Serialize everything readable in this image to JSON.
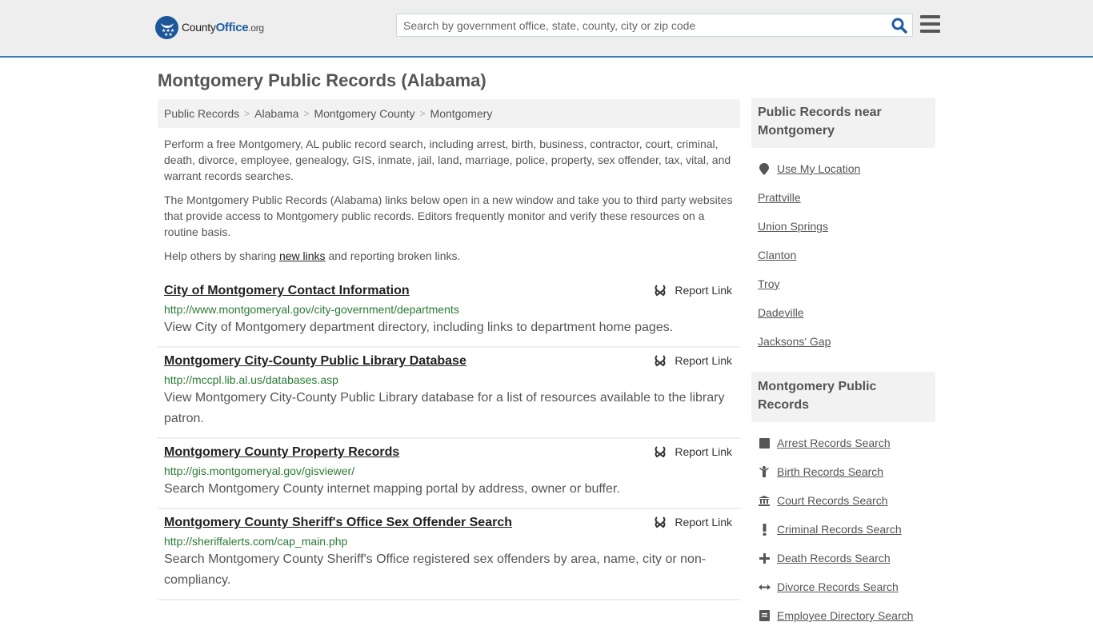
{
  "header": {
    "logo": {
      "county": "County",
      "office": "Office",
      "tld": ".org"
    },
    "search": {
      "placeholder": "Search by government office, state, county, city or zip code",
      "value": ""
    }
  },
  "page_title": "Montgomery Public Records (Alabama)",
  "breadcrumb": [
    "Public Records",
    "Alabama",
    "Montgomery County",
    "Montgomery"
  ],
  "intro": {
    "p1": "Perform a free Montgomery, AL public record search, including arrest, birth, business, contractor, court, criminal, death, divorce, employee, genealogy, GIS, inmate, jail, land, marriage, police, property, sex offender, tax, vital, and warrant records searches.",
    "p2": "The Montgomery Public Records (Alabama) links below open in a new window and take you to third party websites that provide access to Montgomery public records. Editors frequently monitor and verify these resources on a routine basis.",
    "p3_before": "Help others by sharing ",
    "p3_link": "new links",
    "p3_after": " and reporting broken links."
  },
  "report_label": "Report Link",
  "results": [
    {
      "title": "City of Montgomery Contact Information",
      "url": "http://www.montgomeryal.gov/city-government/departments",
      "desc": "View City of Montgomery department directory, including links to department home pages."
    },
    {
      "title": "Montgomery City-County Public Library Database",
      "url": "http://mccpl.lib.al.us/databases.asp",
      "desc": "View Montgomery City-County Public Library database for a list of resources available to the library patron."
    },
    {
      "title": "Montgomery County Property Records",
      "url": "http://gis.montgomeryal.gov/gisviewer/",
      "desc": "Search Montgomery County internet mapping portal by address, owner or buffer."
    },
    {
      "title": "Montgomery County Sheriff's Office Sex Offender Search",
      "url": "http://sheriffalerts.com/cap_main.php",
      "desc": "Search Montgomery County Sheriff's Office registered sex offenders by area, name, city or non-compliancy."
    }
  ],
  "sidebar": {
    "nearby": {
      "heading": "Public Records near Montgomery",
      "use_location": "Use My Location",
      "cities": [
        "Prattville",
        "Union Springs",
        "Clanton",
        "Troy",
        "Dadeville",
        "Jacksons' Gap"
      ]
    },
    "records": {
      "heading": "Montgomery Public Records",
      "items": [
        {
          "label": "Arrest Records Search",
          "icon": "arrest-icon"
        },
        {
          "label": "Birth Records Search",
          "icon": "birth-icon"
        },
        {
          "label": "Court Records Search",
          "icon": "court-icon"
        },
        {
          "label": "Criminal Records Search",
          "icon": "criminal-icon"
        },
        {
          "label": "Death Records Search",
          "icon": "death-icon"
        },
        {
          "label": "Divorce Records Search",
          "icon": "divorce-icon"
        },
        {
          "label": "Employee Directory Search",
          "icon": "employee-icon"
        }
      ]
    }
  },
  "colors": {
    "accent_blue": "#1e5da3",
    "header_border": "#3a7bb5",
    "url_green": "#2a7a32"
  }
}
